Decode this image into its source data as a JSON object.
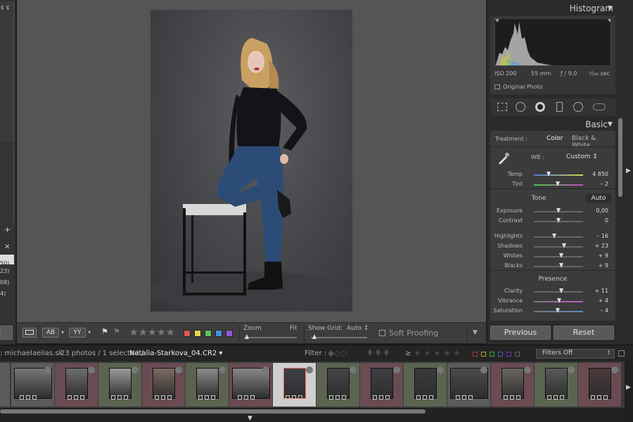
{
  "left_panel": {
    "top_text": "¢ ¢",
    "counts": [
      "50)",
      "23)",
      "08)",
      "4)"
    ],
    "plus": "+",
    "close": "✕"
  },
  "toolbar": {
    "view_ab_label": "AB",
    "view_yy_label": "YY",
    "stars": [
      "★",
      "★",
      "★",
      "★",
      "★"
    ],
    "label_colors": [
      "#e05555",
      "#e0d84a",
      "#59c55a",
      "#4a8de0",
      "#8e57d6"
    ],
    "zoom_label": "Zoom",
    "zoom_fit": "Fit",
    "grid_label": "Show Grid:",
    "grid_value": "Auto ↕",
    "soft_proofing": "Soft Proofing",
    "menu_caret": "▼"
  },
  "right_panel": {
    "histogram_title": "Histogram",
    "iso": "ISO 200",
    "focal": "55 mm",
    "aperture": "ƒ / 9,0",
    "shutter": "¹⁄₁₆₀ sec",
    "original_photo": "Original Photo",
    "basic_title": "Basic",
    "treatment_label": "Treatment :",
    "treatment_color": "Color",
    "treatment_bw": "Black & White",
    "wb_label": "WB :",
    "wb_value": "Custom ↕",
    "tone_label": "Tone",
    "tone_auto": "Auto",
    "presence_label": "Presence",
    "sliders": [
      {
        "name": "Temp",
        "value": "4 850",
        "pos": 0.3
      },
      {
        "name": "Tint",
        "value": "– 2",
        "pos": 0.48
      },
      {
        "name": "Exposure",
        "value": "0,00",
        "pos": 0.5
      },
      {
        "name": "Contrast",
        "value": "0",
        "pos": 0.5
      },
      {
        "name": "Highlights",
        "value": "– 16",
        "pos": 0.42
      },
      {
        "name": "Shadows",
        "value": "+ 23",
        "pos": 0.61
      },
      {
        "name": "Whites",
        "value": "+ 9",
        "pos": 0.55
      },
      {
        "name": "Blacks",
        "value": "+ 9",
        "pos": 0.55
      },
      {
        "name": "Clarity",
        "value": "+ 11",
        "pos": 0.55
      },
      {
        "name": "Vibrance",
        "value": "+ 4",
        "pos": 0.52
      },
      {
        "name": "Saturation",
        "value": "– 4",
        "pos": 0.48
      }
    ],
    "previous_label": "Previous",
    "reset_label": "Reset"
  },
  "filmstrip_bar": {
    "source": ": michaelaelias.sk",
    "count": "23 photos / 1 selected /",
    "filename": "Natalia-Starkova_04.CR2 ▾",
    "filter_label": "Filter :",
    "ge": "≥",
    "filter_stars": [
      "★",
      "★",
      "★",
      "★",
      "★"
    ],
    "filters_off": "Filters Off"
  },
  "filmstrip": {
    "thumbs": [
      {
        "bg": "#5b5b5b",
        "img": "#777",
        "kind": "landscape"
      },
      {
        "bg": "#6a4b52",
        "img": "#6e6e6e",
        "kind": "portrait"
      },
      {
        "bg": "#5b6450",
        "img": "#9a9a9a",
        "kind": "portrait"
      },
      {
        "bg": "#6a4b52",
        "img": "#7c6a62",
        "kind": "portrait"
      },
      {
        "bg": "#5b6450",
        "img": "#8a8a8a",
        "kind": "portrait"
      },
      {
        "bg": "#6a4b52",
        "img": "#888",
        "kind": "landscape"
      },
      {
        "bg": "#cfcfcf",
        "img": "#3e4048",
        "kind": "portrait",
        "selected": true
      },
      {
        "bg": "#5b6450",
        "img": "#444",
        "kind": "portrait"
      },
      {
        "bg": "#6a4b52",
        "img": "#3d3f44",
        "kind": "portrait"
      },
      {
        "bg": "#5b6450",
        "img": "#3a3a3a",
        "kind": "portrait"
      },
      {
        "bg": "#5b5b5b",
        "img": "#4a4a4a",
        "kind": "landscape"
      },
      {
        "bg": "#6a4b52",
        "img": "#6a6560",
        "kind": "portrait"
      },
      {
        "bg": "#5b6450",
        "img": "#5a5a5a",
        "kind": "portrait"
      },
      {
        "bg": "#6a4b52",
        "img": "#4b3a3c",
        "kind": "portrait"
      }
    ]
  }
}
